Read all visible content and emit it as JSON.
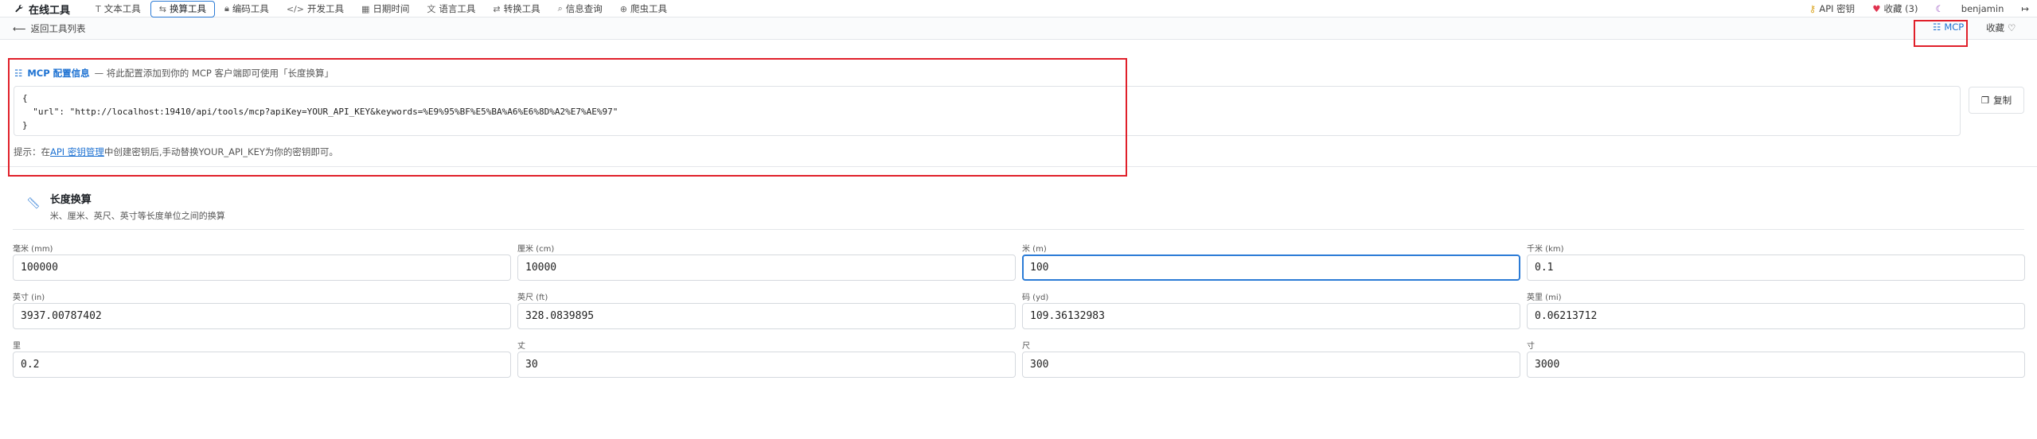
{
  "nav": {
    "brand": "在线工具",
    "tabs": [
      {
        "label": "文本工具",
        "icon": "T"
      },
      {
        "label": "换算工具",
        "icon": "⇆"
      },
      {
        "label": "编码工具",
        "icon": "🔒"
      },
      {
        "label": "开发工具",
        "icon": "</>"
      },
      {
        "label": "日期时间",
        "icon": "▦"
      },
      {
        "label": "语言工具",
        "icon": "文"
      },
      {
        "label": "转换工具",
        "icon": "⇄"
      },
      {
        "label": "信息查询",
        "icon": "⌕"
      },
      {
        "label": "爬虫工具",
        "icon": "⊕"
      }
    ],
    "api_key": "API 密钥",
    "favorites": "收藏 (3)",
    "user": "benjamin"
  },
  "subbar": {
    "back": "返回工具列表",
    "mcp": "MCP",
    "fav": "收藏"
  },
  "mcp": {
    "title": "MCP 配置信息",
    "desc": "— 将此配置添加到你的 MCP 客户端即可使用「长度换算」",
    "code_line1": "{",
    "code_line2": "  \"url\": \"http://localhost:19410/api/tools/mcp?apiKey=YOUR_API_KEY&keywords=%E9%95%BF%E5%BA%A6%E6%8D%A2%E7%AE%97\"",
    "code_line3": "}",
    "copy": "复制",
    "hint_prefix": "提示：在",
    "hint_link": "API 密钥管理",
    "hint_suffix": "中创建密钥后,手动替换YOUR_API_KEY为你的密钥即可。"
  },
  "tool": {
    "name": "长度换算",
    "desc": "米、厘米、英尺、英寸等长度单位之间的换算"
  },
  "fields": [
    {
      "label": "毫米 (mm)",
      "value": "100000"
    },
    {
      "label": "厘米 (cm)",
      "value": "10000"
    },
    {
      "label": "米 (m)",
      "value": "100"
    },
    {
      "label": "千米 (km)",
      "value": "0.1"
    },
    {
      "label": "英寸 (in)",
      "value": "3937.00787402"
    },
    {
      "label": "英尺 (ft)",
      "value": "328.0839895"
    },
    {
      "label": "码 (yd)",
      "value": "109.36132983"
    },
    {
      "label": "英里 (mi)",
      "value": "0.06213712"
    },
    {
      "label": "里",
      "value": "0.2"
    },
    {
      "label": "丈",
      "value": "30"
    },
    {
      "label": "尺",
      "value": "300"
    },
    {
      "label": "寸",
      "value": "3000"
    }
  ],
  "colors": {
    "accent": "#1e72d2",
    "highlight_box": "#e0202a",
    "heart": "#e0334f"
  }
}
